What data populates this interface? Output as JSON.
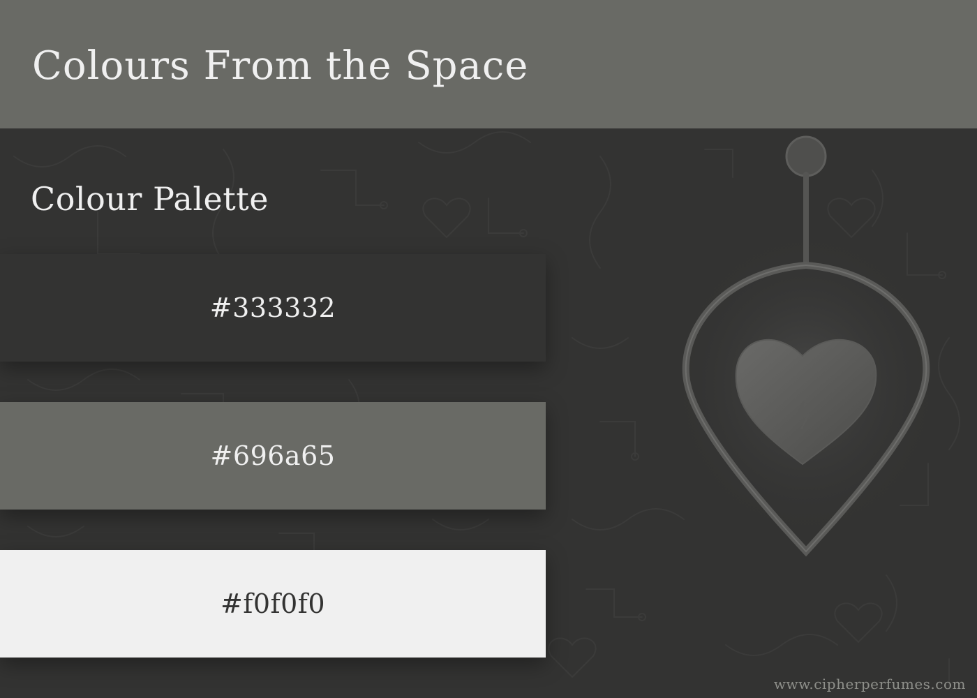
{
  "header": {
    "title": "Colours From the Space"
  },
  "palette": {
    "title": "Colour Palette",
    "swatches": [
      {
        "label": "#333332",
        "color": "#333332",
        "text_color": "#f0f0f0"
      },
      {
        "label": "#696a65",
        "color": "#696a65",
        "text_color": "#f0f0f0"
      },
      {
        "label": "#f0f0f0",
        "color": "#f0f0f0",
        "text_color": "#333332"
      }
    ]
  },
  "footer": {
    "website": "www.cipherperfumes.com"
  }
}
